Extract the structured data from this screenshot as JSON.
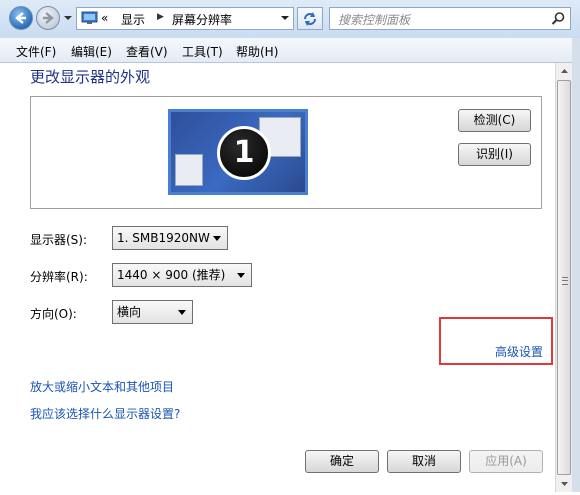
{
  "address": {
    "breadcrumb_prefix": "«",
    "crumbs": [
      "显示",
      "屏幕分辨率"
    ],
    "search_placeholder": "搜索控制面板"
  },
  "menu": [
    "文件(F)",
    "编辑(E)",
    "查看(V)",
    "工具(T)",
    "帮助(H)"
  ],
  "page": {
    "title": "更改显示器的外观",
    "monitor_number": "1",
    "detect_button": "检测(C)",
    "identify_button": "识别(I)"
  },
  "settings": {
    "display_label": "显示器(S):",
    "display_value": "1. SMB1920NW",
    "resolution_label": "分辨率(R):",
    "resolution_value": "1440 × 900 (推荐)",
    "orientation_label": "方向(O):",
    "orientation_value": "横向"
  },
  "links": {
    "advanced": "高级设置",
    "text_size": "放大或缩小文本和其他项目",
    "which_settings": "我应该选择什么显示器设置?"
  },
  "footer": {
    "ok": "确定",
    "cancel": "取消",
    "apply": "应用(A)"
  },
  "colors": {
    "accent_title": "#1e3287",
    "link": "#1a55b3",
    "highlight_box": "#e0393b"
  }
}
